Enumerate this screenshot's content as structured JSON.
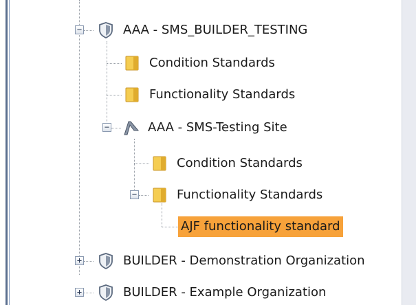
{
  "tree": {
    "nodes": [
      {
        "label": "AAA - SMS_BUILDER_TESTING",
        "icon": "shield-icon",
        "expander": "minus"
      },
      {
        "label": "Condition Standards",
        "icon": "folder-icon"
      },
      {
        "label": "Functionality Standards",
        "icon": "folder-icon"
      },
      {
        "label": "AAA - SMS-Testing Site",
        "icon": "site-icon",
        "expander": "minus"
      },
      {
        "label": "Condition Standards",
        "icon": "folder-icon"
      },
      {
        "label": "Functionality Standards",
        "icon": "folder-icon",
        "expander": "minus"
      },
      {
        "label": "AJF functionality standard",
        "selected": true
      },
      {
        "label": "BUILDER - Demonstration Organization",
        "icon": "shield-icon",
        "expander": "plus"
      },
      {
        "label": "BUILDER - Example Organization",
        "icon": "shield-icon",
        "expander": "plus"
      }
    ],
    "expander_glyphs": {
      "minus": "−",
      "plus": "+"
    },
    "colors": {
      "selection": "#f7a23a",
      "folder": "#f2c94c",
      "shield": "#6b7b93"
    }
  }
}
